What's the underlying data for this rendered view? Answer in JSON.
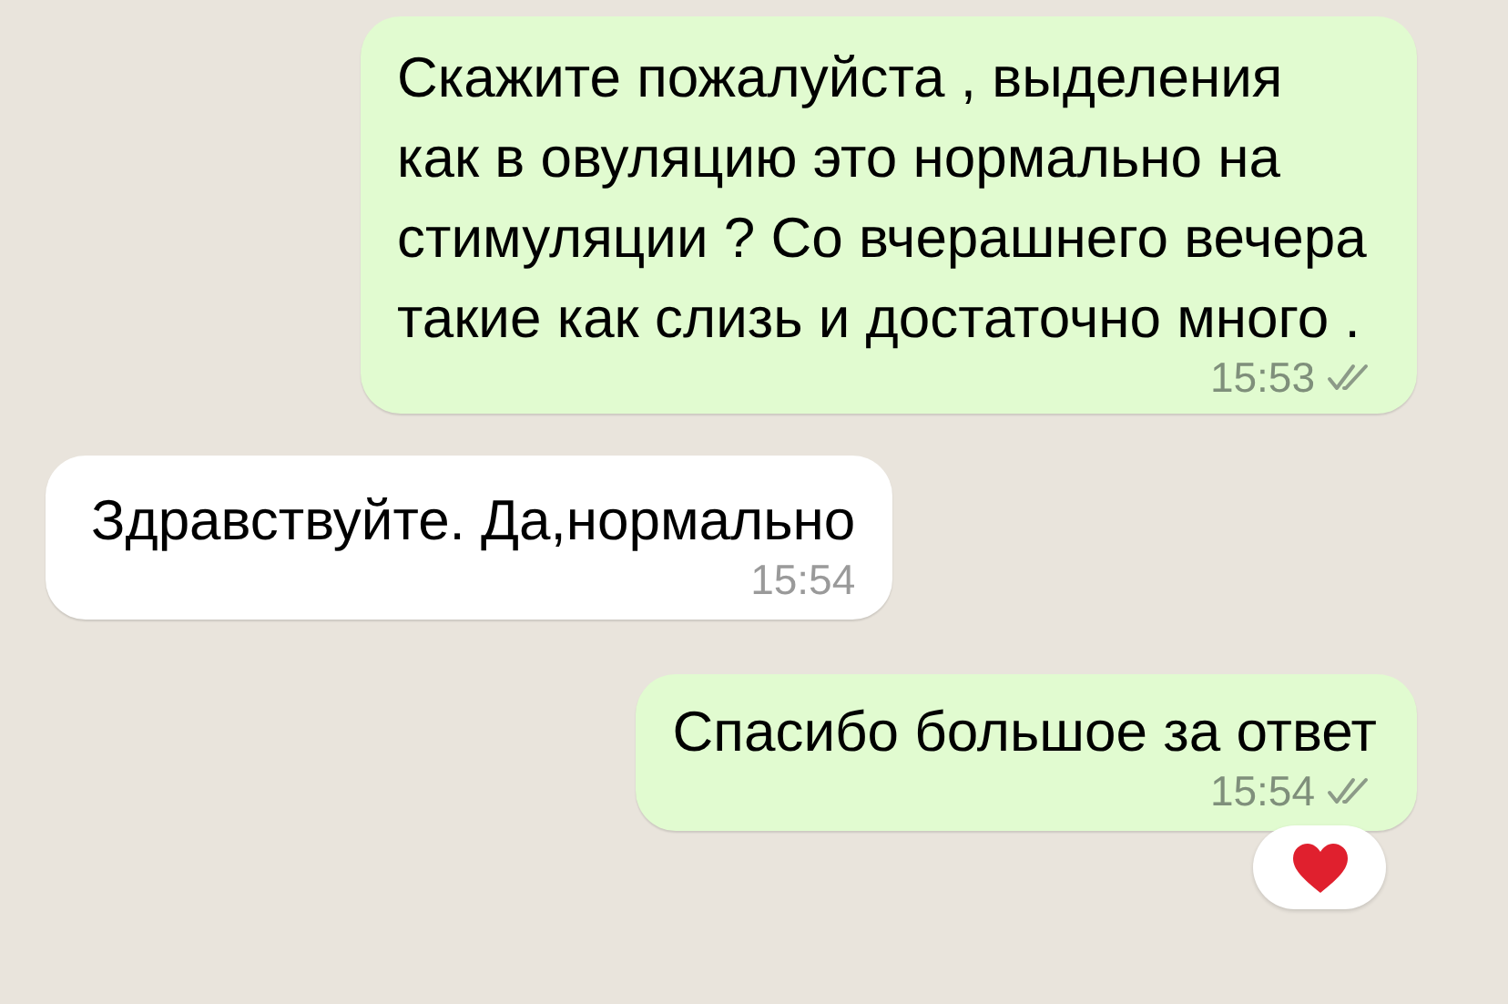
{
  "messages": [
    {
      "outgoing": true,
      "text": "Скажите пожалуйста , выделения как в овуляцию это нормально на стимуляции ? Со вчерашнего вечера такие как слизь и достаточно много .",
      "time": "15:53",
      "read": false
    },
    {
      "outgoing": false,
      "text": "Здравствуйте. Да,нормально",
      "time": "15:54"
    },
    {
      "outgoing": true,
      "text": "Спасибо большое за ответ",
      "time": "15:54",
      "read": false,
      "reaction": {
        "kind": "heart"
      }
    }
  ]
}
